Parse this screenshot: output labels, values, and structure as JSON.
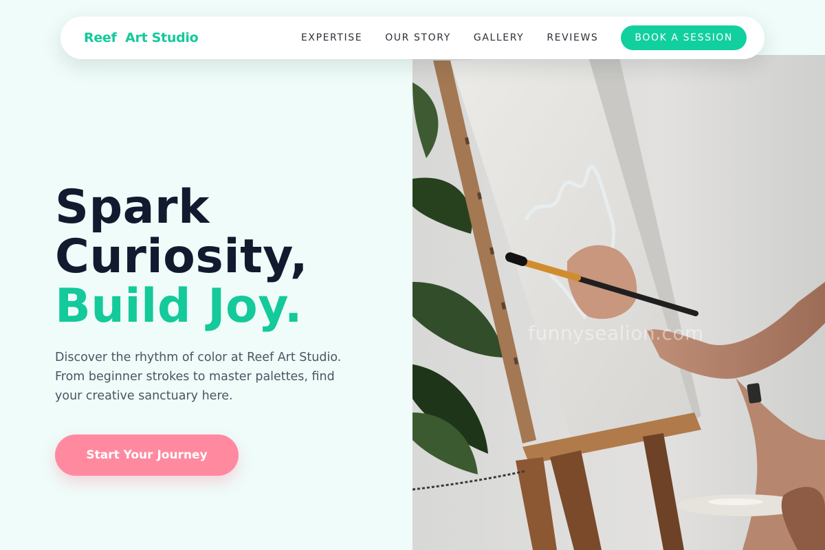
{
  "brand": {
    "name": "Reef  Art Studio"
  },
  "nav": {
    "links": [
      "EXPERTISE",
      "OUR STORY",
      "GALLERY",
      "REVIEWS"
    ],
    "cta_label": "BOOK A SESSION"
  },
  "hero": {
    "headline_line1": "Spark",
    "headline_line2": "Curiosity,",
    "headline_accent": "Build Joy.",
    "description": "Discover the rhythm of color at Reef Art Studio. From beginner strokes to master palettes, find your creative sanctuary here.",
    "cta_label": "Start Your Journey"
  },
  "photo": {
    "watermark": "funnysealion.com",
    "subject": "painter-at-easel"
  },
  "colors": {
    "accent": "#14c99a",
    "cta_pink": "#ff8aa0",
    "heading": "#111a2e",
    "background": "#effcf9"
  }
}
